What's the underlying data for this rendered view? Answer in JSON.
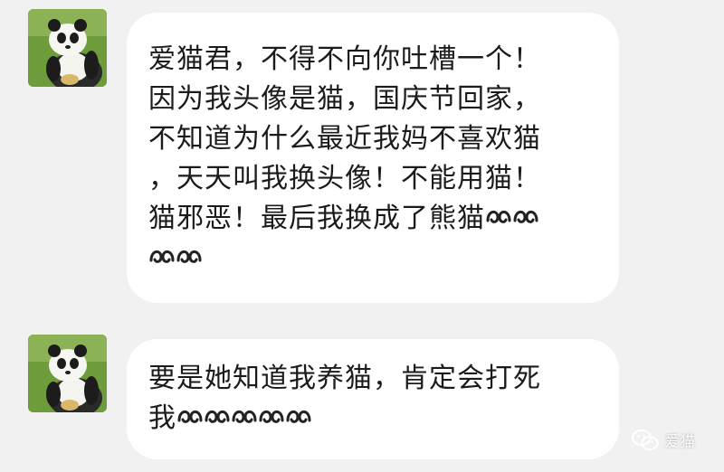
{
  "messages": [
    {
      "avatar_icon": "panda-avatar-icon",
      "lines": [
        "爱猫君，不得不向你吐槽一个！",
        "因为我头像是猫，国庆节回家，",
        "不知道为什么最近我妈不喜欢猫",
        "，天天叫我换头像！不能用猫！",
        "猫邪恶！最后我换成了熊猫"
      ],
      "trailing_emoji": [
        "face-icon",
        "face-icon",
        "face-icon",
        "face-icon"
      ]
    },
    {
      "avatar_icon": "panda-avatar-icon",
      "lines": [
        "要是她知道我养猫，肯定会打死",
        "我"
      ],
      "trailing_emoji": [
        "face-icon",
        "face-icon",
        "face-icon",
        "face-icon",
        "face-icon"
      ]
    }
  ],
  "watermark": {
    "icon": "wechat-icon",
    "text": "爱猫"
  },
  "colors": {
    "background": "#f1f1f1",
    "bubble": "#ffffff",
    "text": "#1b1b1b"
  }
}
